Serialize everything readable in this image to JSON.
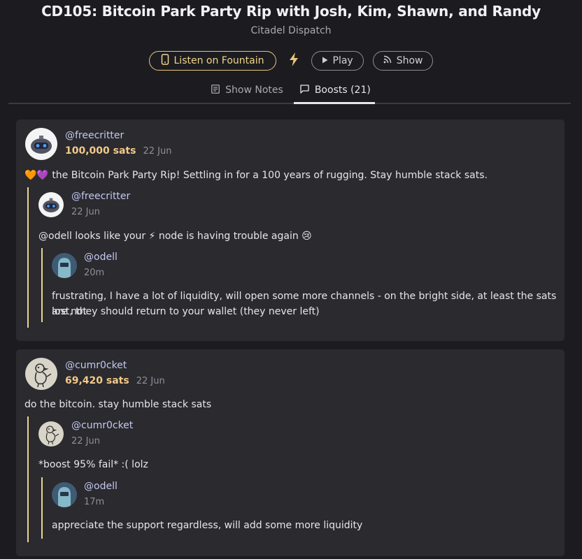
{
  "header": {
    "title": "CD105: Bitcoin Park Party Rip with Josh, Kim, Shawn, and Randy",
    "subtitle": "Citadel Dispatch"
  },
  "actions": {
    "fountain_label": "Listen on Fountain",
    "play_label": "Play",
    "show_label": "Show"
  },
  "tabs": [
    {
      "label": "Show Notes"
    },
    {
      "label": "Boosts (21)"
    }
  ],
  "colors": {
    "accent_gold": "#e8c67a",
    "sats_color": "#f2c98a",
    "username_color": "#c4c8f0"
  },
  "boosts": [
    {
      "user": "@freecritter",
      "sats": "100,000 sats",
      "date": "22 Jun",
      "message": "🧡💜 the Bitcoin Park Party Rip! Settling in for a 100 years of rugging. Stay humble stack sats.",
      "reply": {
        "user": "@freecritter",
        "date": "22 Jun",
        "message": "@odell looks like your ⚡ node is having trouble again 😢",
        "reply": {
          "user": "@odell",
          "date": "20m",
          "message_line1": "frustrating, I have a lot of liquidity, will open some more channels - on the bright side, at least the sats are not",
          "message_line2": "lost, they should return to your wallet (they never left)"
        }
      }
    },
    {
      "user": "@cumr0cket",
      "sats": "69,420 sats",
      "date": "22 Jun",
      "message": "do the bitcoin. stay humble stack sats",
      "reply": {
        "user": "@cumr0cket",
        "date": "22 Jun",
        "message": "*boost 95% fail* :( lolz",
        "reply": {
          "user": "@odell",
          "date": "17m",
          "message": "appreciate the support regardless, will add some more liquidity"
        }
      }
    }
  ]
}
